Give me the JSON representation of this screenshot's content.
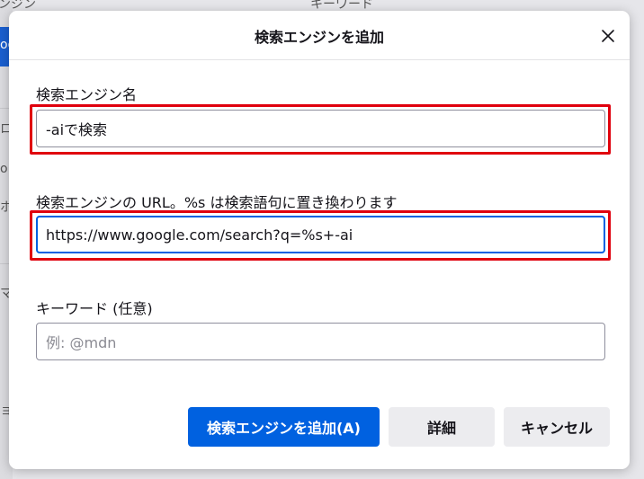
{
  "background": {
    "fragments": [
      "ンジン",
      "キーワード",
      "ogl",
      "ロ",
      "o",
      "ホ",
      "マ",
      "ョ"
    ]
  },
  "dialog": {
    "title": "検索エンジンを追加",
    "close_icon": "close-icon",
    "fields": {
      "name": {
        "label": "検索エンジン名",
        "value": "-aiで検索"
      },
      "url": {
        "label": "検索エンジンの URL。%s は検索語句に置き換わります",
        "value": "https://www.google.com/search?q=%s+-ai"
      },
      "keyword": {
        "label": "キーワード (任意)",
        "value": "",
        "placeholder": "例: @mdn"
      }
    },
    "buttons": {
      "add": "検索エンジンを追加(A)",
      "details": "詳細",
      "cancel": "キャンセル"
    }
  },
  "colors": {
    "accent": "#0061e0",
    "highlight": "#e0000d"
  }
}
